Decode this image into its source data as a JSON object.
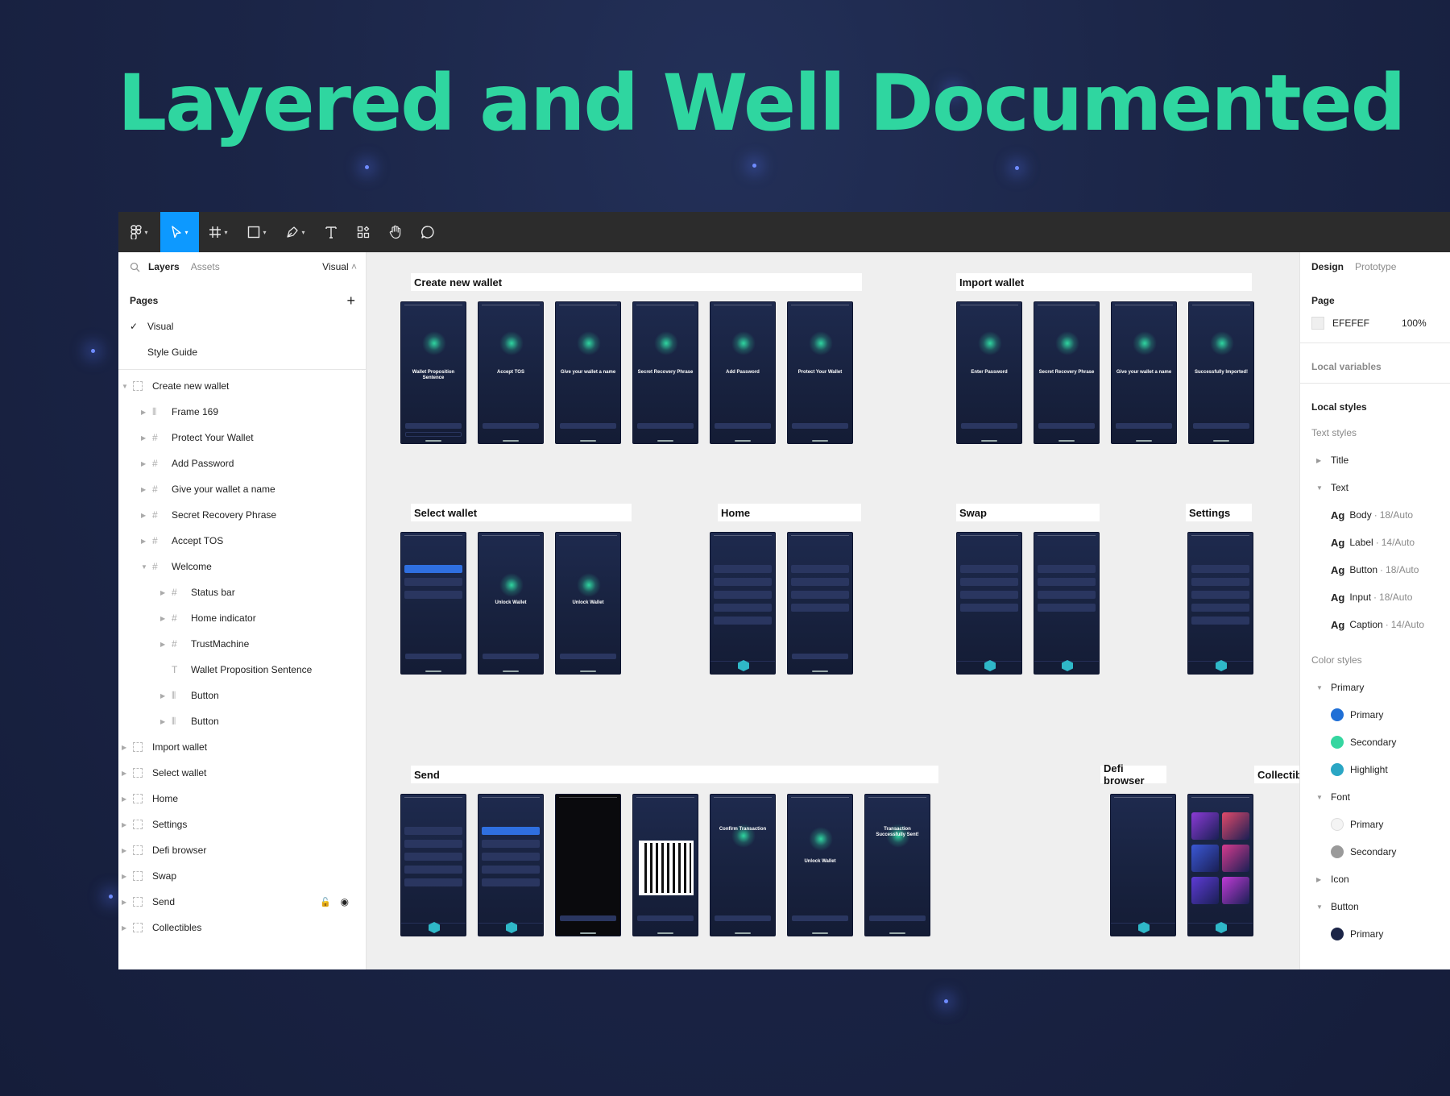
{
  "hero_title": "Layered and Well Documented",
  "toolbar": {
    "tools": [
      "figma-menu-icon",
      "move-icon",
      "frame-icon",
      "shape-icon",
      "pen-icon",
      "text-icon",
      "components-icon",
      "hand-icon",
      "comment-icon"
    ]
  },
  "left_panel": {
    "tabs": {
      "layers": "Layers",
      "assets": "Assets"
    },
    "page_selector": "Visual",
    "pages_heading": "Pages",
    "pages": [
      "Visual",
      "Style Guide"
    ],
    "layers": [
      {
        "label": "Create new wallet",
        "depth": 0,
        "kind": "section"
      },
      {
        "label": "Frame 169",
        "depth": 1,
        "kind": "auto"
      },
      {
        "label": "Protect Your Wallet",
        "depth": 1,
        "kind": "frame"
      },
      {
        "label": "Add Password",
        "depth": 1,
        "kind": "frame"
      },
      {
        "label": "Give your wallet a name",
        "depth": 1,
        "kind": "frame"
      },
      {
        "label": "Secret Recovery Phrase",
        "depth": 1,
        "kind": "frame"
      },
      {
        "label": "Accept TOS",
        "depth": 1,
        "kind": "frame"
      },
      {
        "label": "Welcome",
        "depth": 1,
        "kind": "frame"
      },
      {
        "label": "Status bar",
        "depth": 2,
        "kind": "frame"
      },
      {
        "label": "Home indicator",
        "depth": 2,
        "kind": "frame"
      },
      {
        "label": "TrustMachine",
        "depth": 2,
        "kind": "frame"
      },
      {
        "label": "Wallet Proposition Sentence",
        "depth": 2,
        "kind": "text"
      },
      {
        "label": "Button",
        "depth": 2,
        "kind": "auto"
      },
      {
        "label": "Button",
        "depth": 2,
        "kind": "auto"
      },
      {
        "label": "Import wallet",
        "depth": 0,
        "kind": "section"
      },
      {
        "label": "Select wallet",
        "depth": 0,
        "kind": "section"
      },
      {
        "label": "Home",
        "depth": 0,
        "kind": "section"
      },
      {
        "label": "Settings",
        "depth": 0,
        "kind": "section"
      },
      {
        "label": "Defi browser",
        "depth": 0,
        "kind": "section"
      },
      {
        "label": "Swap",
        "depth": 0,
        "kind": "section"
      },
      {
        "label": "Send",
        "depth": 0,
        "kind": "section"
      },
      {
        "label": "Collectibles",
        "depth": 0,
        "kind": "section"
      }
    ]
  },
  "canvas": {
    "sections": [
      "Create new wallet",
      "Import wallet",
      "Select wallet",
      "Home",
      "Swap",
      "Settings",
      "Send",
      "Defi browser",
      "Collectibles"
    ],
    "create_screens": [
      "Wallet Proposition Sentence",
      "Accept TOS",
      "Give your wallet a name",
      "Secret Recovery Phrase",
      "Add Password",
      "Protect Your Wallet"
    ],
    "import_screens": [
      "Enter Password",
      "Secret Recovery Phrase",
      "Give your wallet a name",
      "Successfully Imported!"
    ],
    "select_screens": [
      "",
      "Unlock Wallet",
      "Unlock Wallet"
    ],
    "send_screens": [
      "",
      "",
      "",
      "",
      "Confirm Transaction",
      "Unlock Wallet",
      "Transaction Successfully Sent!"
    ]
  },
  "right_panel": {
    "tabs": {
      "design": "Design",
      "prototype": "Prototype"
    },
    "page_heading": "Page",
    "page_color": "EFEFEF",
    "page_opacity": "100%",
    "local_variables": "Local variables",
    "local_styles": "Local styles",
    "text_styles_heading": "Text styles",
    "text_groups": [
      "Title",
      "Text"
    ],
    "text_styles": [
      {
        "name": "Body",
        "spec": "18/Auto"
      },
      {
        "name": "Label",
        "spec": "14/Auto"
      },
      {
        "name": "Button",
        "spec": "18/Auto"
      },
      {
        "name": "Input",
        "spec": "18/Auto"
      },
      {
        "name": "Caption",
        "spec": "14/Auto"
      }
    ],
    "ag_glyph": "Ag",
    "color_styles_heading": "Color styles",
    "color_groups": [
      "Primary",
      "Font",
      "Icon",
      "Button"
    ],
    "primary_colors": [
      {
        "name": "Primary",
        "color": "#1f6fd6"
      },
      {
        "name": "Secondary",
        "color": "#35d6a0"
      },
      {
        "name": "Highlight",
        "color": "#2aa6c4"
      }
    ],
    "font_colors": [
      {
        "name": "Primary",
        "color": "#f4f4f4"
      },
      {
        "name": "Secondary",
        "color": "#9a9a9a"
      }
    ],
    "button_colors": [
      {
        "name": "Primary",
        "color": "#1b2547"
      }
    ]
  }
}
